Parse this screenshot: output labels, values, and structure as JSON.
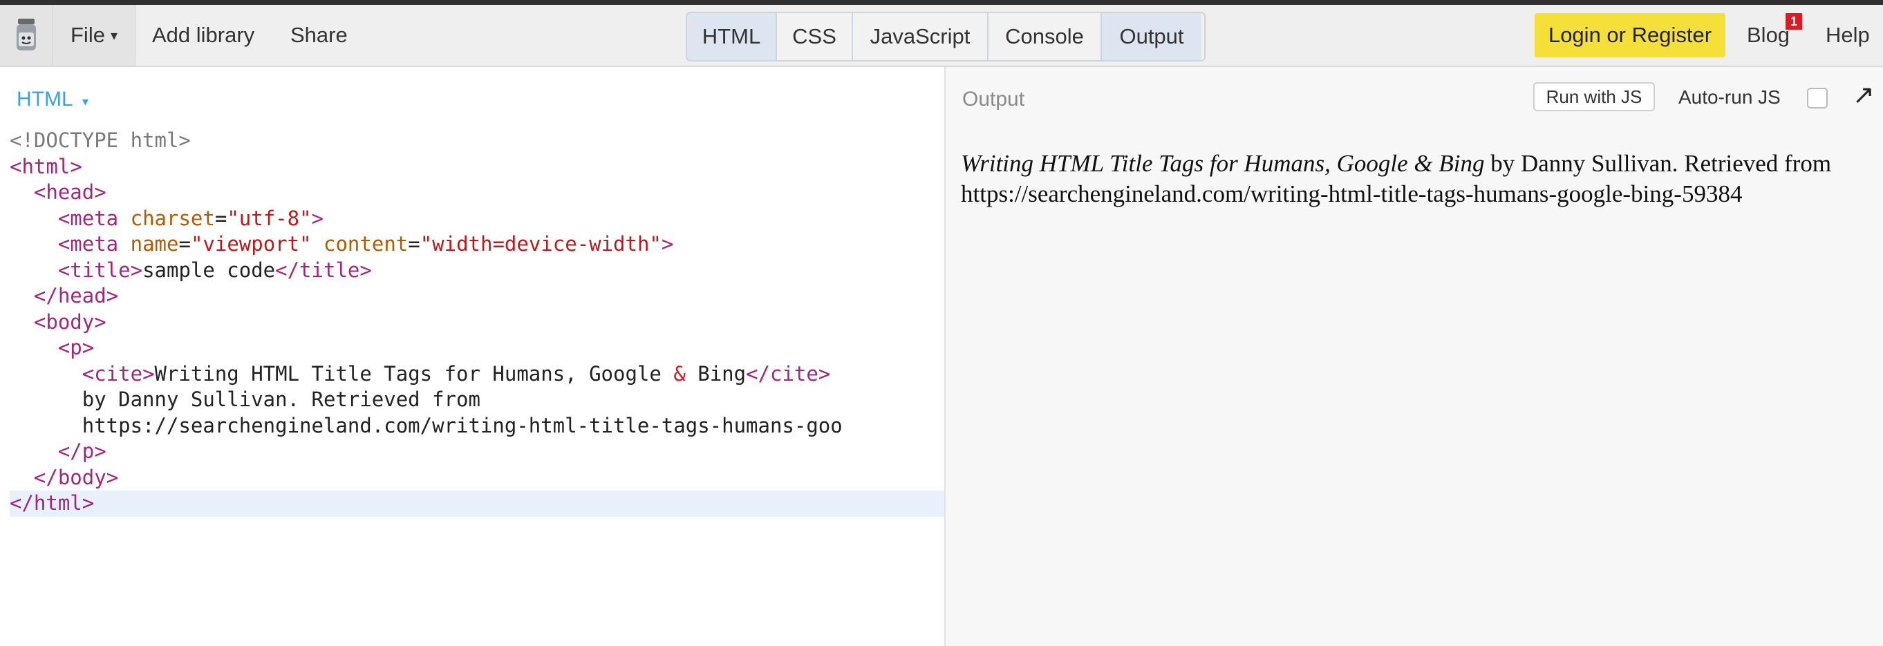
{
  "toolbar": {
    "logo_icon": "jsbin-jar-icon",
    "file_label": "File",
    "add_library_label": "Add library",
    "share_label": "Share",
    "tabs": [
      {
        "label": "HTML",
        "active": true
      },
      {
        "label": "CSS",
        "active": false
      },
      {
        "label": "JavaScript",
        "active": false
      },
      {
        "label": "Console",
        "active": false
      },
      {
        "label": "Output",
        "active": true
      }
    ],
    "login_label": "Login or Register",
    "blog_label": "Blog",
    "blog_badge": "1",
    "help_label": "Help",
    "accent_color": "#f5e03a"
  },
  "editor": {
    "panel_label": "HTML",
    "code_lines": [
      "<!DOCTYPE html>",
      "<html>",
      "  <head>",
      "    <meta charset=\"utf-8\">",
      "    <meta name=\"viewport\" content=\"width=device-width\">",
      "    <title>sample code</title>",
      "  </head>",
      "  <body>",
      "    <p>",
      "      <cite>Writing HTML Title Tags for Humans, Google & Bing</cite>",
      "      by Danny Sullivan. Retrieved from",
      "      https://searchengineland.com/writing-html-title-tags-humans-goo",
      "    </p>",
      "  </body>",
      "</html>"
    ]
  },
  "output": {
    "panel_label": "Output",
    "run_button": "Run with JS",
    "autorun_label": "Auto-run JS",
    "autorun_checked": false,
    "cite_text": "Writing HTML Title Tags for Humans, Google & Bing",
    "rest_text": " by Danny Sullivan. Retrieved from https://searchengineland.com/writing-html-title-tags-humans-google-bing-59384"
  }
}
